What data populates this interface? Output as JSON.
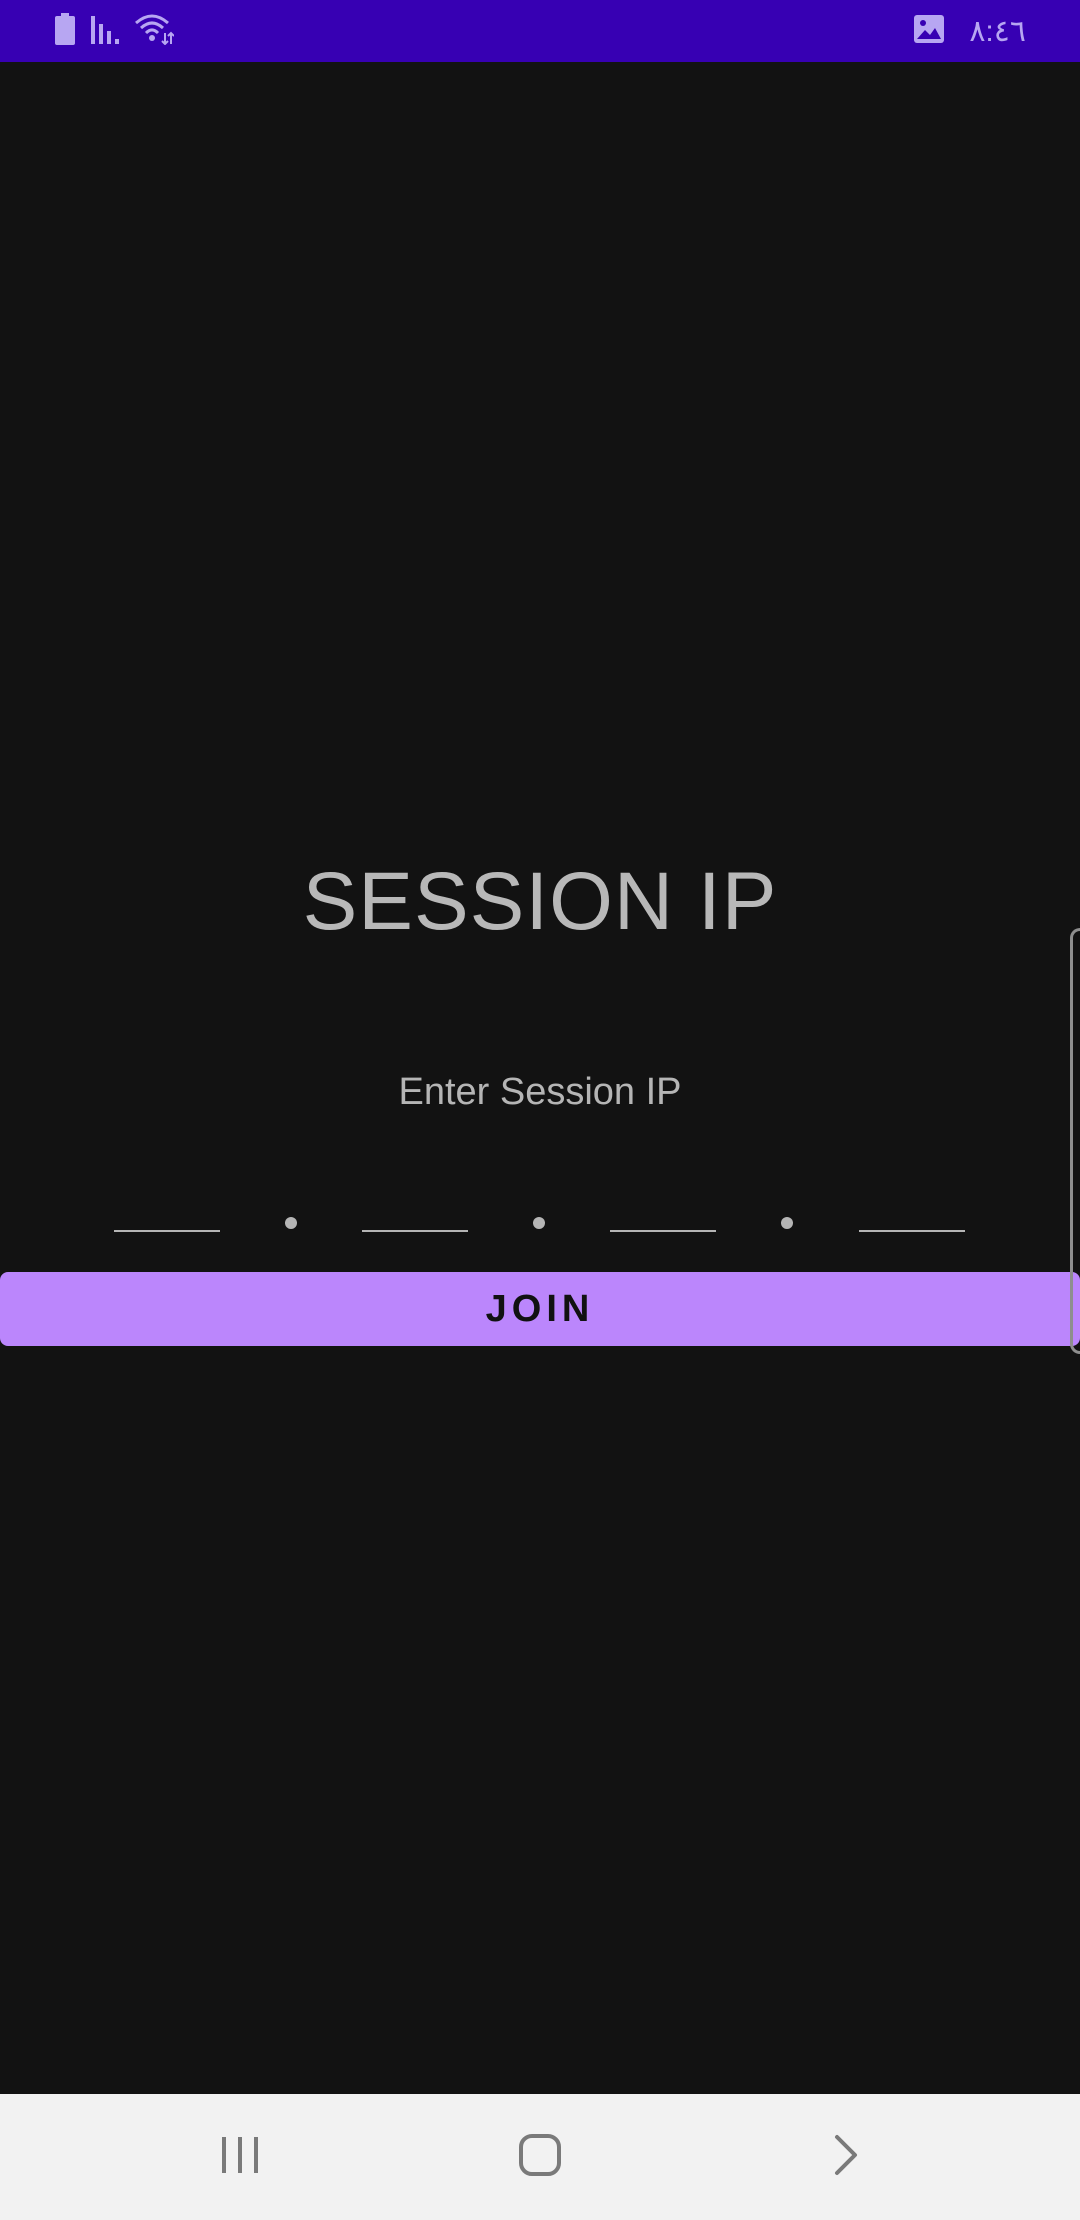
{
  "status_bar": {
    "time": "٨:٤٦",
    "icons": [
      "battery-icon",
      "signal-icon",
      "wifi-icon",
      "gallery-notification-icon"
    ],
    "background_color": "#3700B3",
    "icon_color": "#B7A6F2"
  },
  "main": {
    "title": "SESSION IP",
    "instruction": "Enter Session IP",
    "ip_fields": [
      {
        "value": "",
        "placeholder": ""
      },
      {
        "value": "",
        "placeholder": ""
      },
      {
        "value": "",
        "placeholder": ""
      },
      {
        "value": "",
        "placeholder": ""
      }
    ],
    "join_label": "JOIN",
    "background_color": "#121212",
    "accent_color": "#BB86FC"
  },
  "nav_bar": {
    "icons": [
      "recent-apps-icon",
      "home-icon",
      "back-icon"
    ],
    "background_color": "#F2F2F2"
  }
}
